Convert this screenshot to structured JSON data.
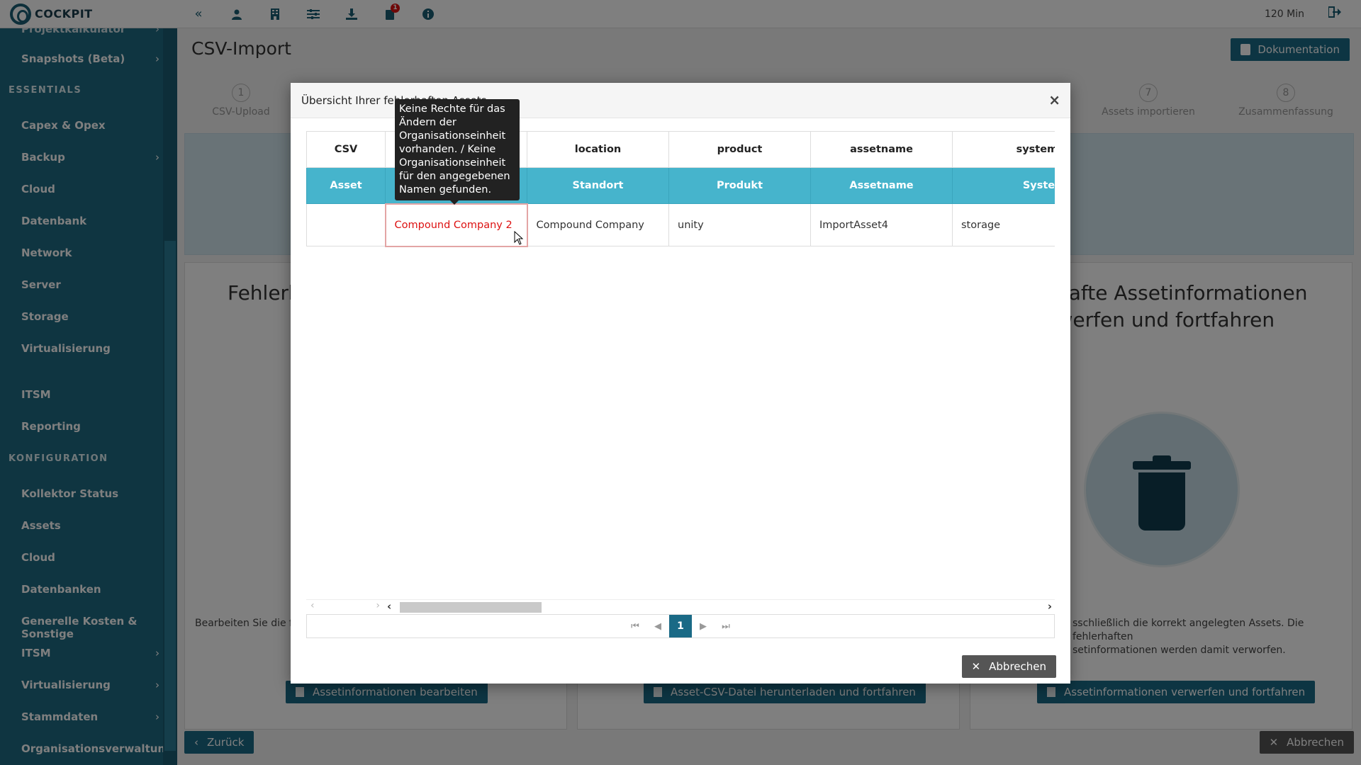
{
  "app": {
    "logo_text": "COCKPIT",
    "session_time": "120 Min",
    "brand_color": "#1e6b83",
    "accent_color": "#46b4cc"
  },
  "topbar": {
    "icons": [
      "collapse-icon",
      "user-icon",
      "building-icon",
      "sliders-icon",
      "download-icon",
      "notification-icon",
      "info-icon"
    ],
    "notification_badge": "1"
  },
  "sidebar": {
    "items": [
      {
        "label": "Snapshots (Beta)",
        "chevron": "›"
      },
      {
        "label": "Capex & Opex",
        "chevron": ""
      },
      {
        "label": "Backup",
        "chevron": "›"
      },
      {
        "label": "Cloud",
        "chevron": ""
      },
      {
        "label": "Datenbank",
        "chevron": ""
      },
      {
        "label": "Network",
        "chevron": ""
      },
      {
        "label": "Server",
        "chevron": ""
      },
      {
        "label": "Storage",
        "chevron": ""
      },
      {
        "label": "Virtualisierung",
        "chevron": ""
      },
      {
        "label": "ITSM",
        "chevron": ""
      },
      {
        "label": "Reporting",
        "chevron": ""
      },
      {
        "label": "Kollektor Status",
        "chevron": ""
      },
      {
        "label": "Assets",
        "chevron": ""
      },
      {
        "label": "Cloud",
        "chevron": ""
      },
      {
        "label": "Datenbanken",
        "chevron": ""
      },
      {
        "label": "Generelle Kosten & Sonstige",
        "chevron": ""
      },
      {
        "label": "ITSM",
        "chevron": "›"
      },
      {
        "label": "Virtualisierung",
        "chevron": "›"
      },
      {
        "label": "Stammdaten",
        "chevron": "›"
      },
      {
        "label": "Organisationsverwaltung",
        "chevron": ""
      }
    ],
    "headings": [
      "ESSENTIALS",
      "KONFIGURATION"
    ]
  },
  "main": {
    "title": "CSV-Import",
    "doc_button": "Dokumentation",
    "steps": [
      {
        "num": "1",
        "label": "CSV-Upload"
      },
      {
        "num": "7",
        "label": "Assets importieren"
      },
      {
        "num": "8",
        "label": "Zusammenfassung"
      }
    ],
    "cards": [
      {
        "title": "Fehlerh",
        "desc": "Bearbeiten Sie die fe",
        "button": "Assetinformationen bearbeiten"
      },
      {
        "title": "",
        "desc": "",
        "button": "Asset-CSV-Datei herunterladen und fortfahren"
      },
      {
        "title": "rhafte Assetinformationen\nrwerfen und fortfahren",
        "desc": "sschließlich die korrekt angelegten Assets. Die fehlerhaften\nsetinformationen werden damit verworfen.",
        "button": "Assetinformationen verwerfen und fortfahren"
      }
    ],
    "back_button": "Zurück",
    "cancel_button": "Abbrechen"
  },
  "modal": {
    "title": "Übersicht Ihrer fehlerhaften Assets",
    "close": "×",
    "header_row": [
      "CSV",
      "",
      "location",
      "product",
      "assetname",
      "systemType"
    ],
    "label_row": [
      "Asset",
      "",
      "Standort",
      "Produkt",
      "Assetname",
      "Systemtyp"
    ],
    "data_row": [
      "",
      "Compound Company 2",
      "Compound Company",
      "unity",
      "ImportAsset4",
      "storage"
    ],
    "scroll_left": "‹",
    "scroll_right": "›",
    "pager": {
      "first": "⏮",
      "prev": "◀",
      "current": "1",
      "next": "▶",
      "last": "⏭"
    },
    "cancel_button": "Abbrechen"
  },
  "tooltip": {
    "text": "Keine Rechte für das Ändern der Organisationseinheit vorhanden. / Keine Organisationseinheit für den angegebenen Namen gefunden."
  }
}
